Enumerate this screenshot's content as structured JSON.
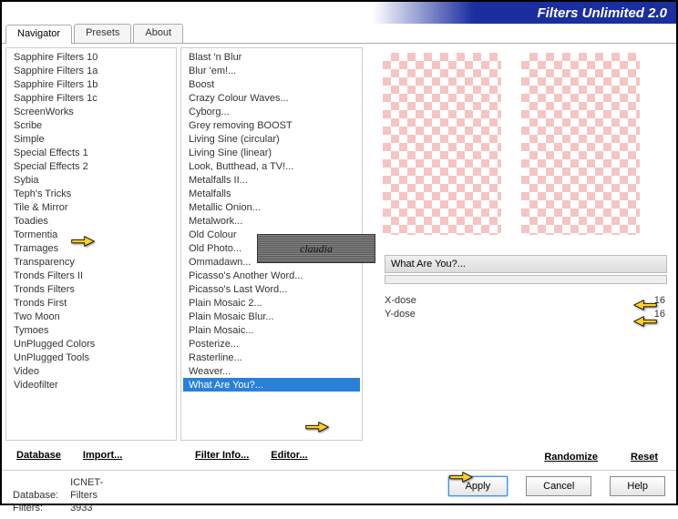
{
  "title": "Filters Unlimited 2.0",
  "tabs": [
    "Navigator",
    "Presets",
    "About"
  ],
  "active_tab": 0,
  "categories": [
    "Sapphire Filters 10",
    "Sapphire Filters 1a",
    "Sapphire Filters 1b",
    "Sapphire Filters 1c",
    "ScreenWorks",
    "Scribe",
    "Simple",
    "Special Effects 1",
    "Special Effects 2",
    "Sybia",
    "Teph's Tricks",
    "Tile & Mirror",
    "Toadies",
    "Tormentia",
    "Tramages",
    "Transparency",
    "Tronds Filters II",
    "Tronds Filters",
    "Tronds First",
    "Two Moon",
    "Tymoes",
    "UnPlugged Colors",
    "UnPlugged Tools",
    "Video",
    "Videofilter"
  ],
  "category_highlight_index": 12,
  "filters": [
    "Blast 'n Blur",
    "Blur 'em!...",
    "Boost",
    "Crazy Colour Waves...",
    "Cyborg...",
    "Grey removing BOOST",
    "Living Sine (circular)",
    "Living Sine (linear)",
    "Look, Butthead, a TV!...",
    "Metalfalls II...",
    "Metalfalls",
    "Metallic Onion...",
    "Metalwork...",
    "Old Colour",
    "Old Photo...",
    "Ommadawn...",
    "Picasso's Another Word...",
    "Picasso's Last Word...",
    "Plain Mosaic 2...",
    "Plain Mosaic Blur...",
    "Plain Mosaic...",
    "Posterize...",
    "Rasterline...",
    "Weaver...",
    "What Are You?..."
  ],
  "filter_selected_index": 24,
  "col1_buttons": {
    "database": "Database",
    "import": "Import..."
  },
  "col2_buttons": {
    "info": "Filter Info...",
    "editor": "Editor..."
  },
  "preview": {
    "stamp": "claudia",
    "filter_name": "What Are You?...",
    "sliders": [
      {
        "label": "X-dose",
        "value": 16
      },
      {
        "label": "Y-dose",
        "value": 16
      }
    ],
    "randomize": "Randomize",
    "reset": "Reset"
  },
  "footer": {
    "db_label": "Database:",
    "db_value": "ICNET-Filters",
    "filters_label": "Filters:",
    "filters_value": "3933",
    "apply": "Apply",
    "cancel": "Cancel",
    "help": "Help"
  }
}
